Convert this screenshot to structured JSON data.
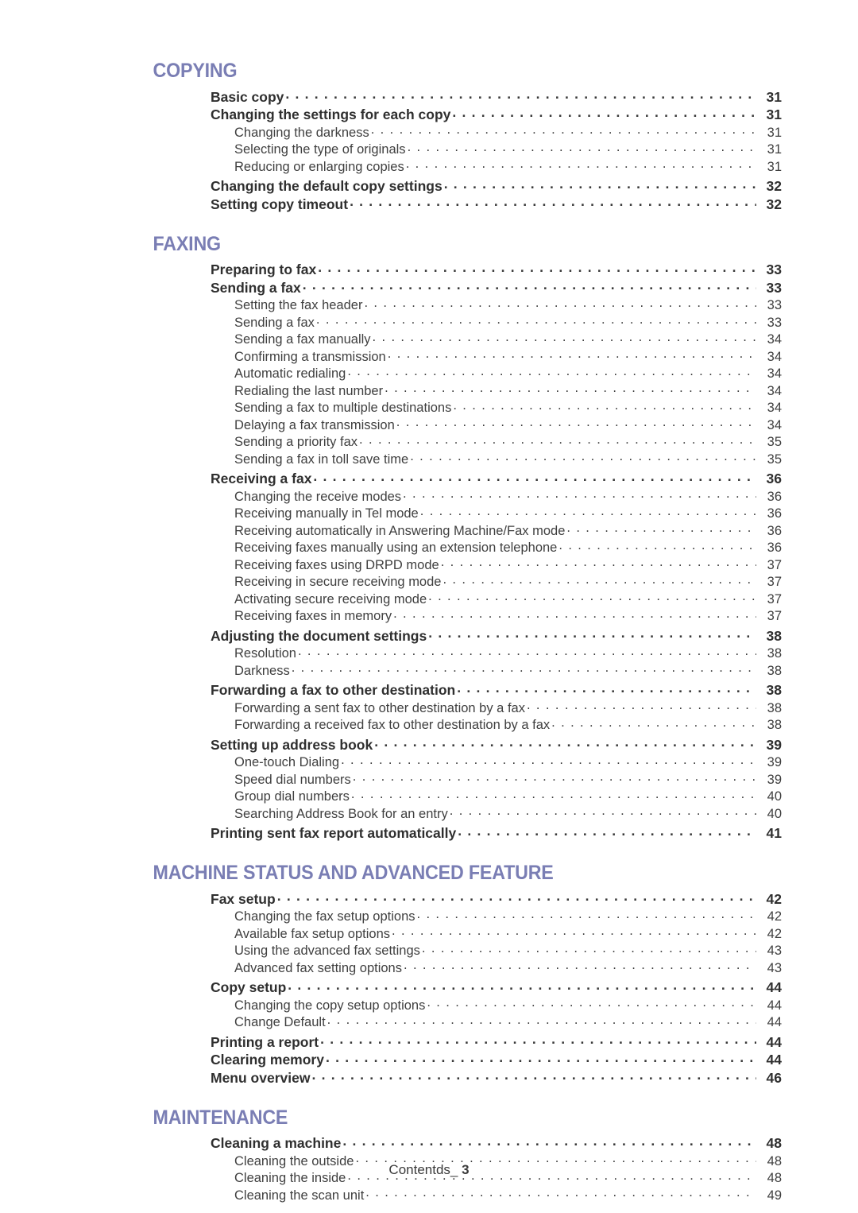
{
  "document": {
    "footer_label": "Contentds_",
    "footer_page_number": "3",
    "heading_color": "#7a7eb4",
    "text_color": "#3a3a3a"
  },
  "sections": [
    {
      "title": "COPYING",
      "entries": [
        {
          "level": 1,
          "label": "Basic copy",
          "page": "31"
        },
        {
          "level": 1,
          "label": "Changing the settings for each copy",
          "page": "31"
        },
        {
          "level": 2,
          "label": "Changing the darkness",
          "page": "31"
        },
        {
          "level": 2,
          "label": "Selecting the type of originals",
          "page": "31"
        },
        {
          "level": 2,
          "label": "Reducing or enlarging copies",
          "page": "31"
        },
        {
          "level": 1,
          "label": "Changing the default copy settings",
          "page": "32"
        },
        {
          "level": 1,
          "label": "Setting copy timeout",
          "page": "32"
        }
      ]
    },
    {
      "title": "FAXING",
      "entries": [
        {
          "level": 1,
          "label": "Preparing to fax",
          "page": "33"
        },
        {
          "level": 1,
          "label": "Sending a fax",
          "page": "33"
        },
        {
          "level": 2,
          "label": "Setting the fax header",
          "page": "33"
        },
        {
          "level": 2,
          "label": "Sending a fax",
          "page": "33"
        },
        {
          "level": 2,
          "label": "Sending a fax manually",
          "page": "34"
        },
        {
          "level": 2,
          "label": "Confirming a transmission",
          "page": "34"
        },
        {
          "level": 2,
          "label": "Automatic redialing",
          "page": "34"
        },
        {
          "level": 2,
          "label": "Redialing the last number",
          "page": "34"
        },
        {
          "level": 2,
          "label": "Sending a fax to multiple destinations",
          "page": "34"
        },
        {
          "level": 2,
          "label": "Delaying a fax transmission",
          "page": "34"
        },
        {
          "level": 2,
          "label": "Sending a priority fax",
          "page": "35"
        },
        {
          "level": 2,
          "label": "Sending a fax in toll save time",
          "page": "35"
        },
        {
          "level": 1,
          "label": "Receiving a fax",
          "page": "36"
        },
        {
          "level": 2,
          "label": "Changing the receive modes",
          "page": "36"
        },
        {
          "level": 2,
          "label": "Receiving manually in Tel mode",
          "page": "36"
        },
        {
          "level": 2,
          "label": "Receiving automatically in Answering Machine/Fax mode",
          "page": "36"
        },
        {
          "level": 2,
          "label": "Receiving faxes manually using an extension telephone",
          "page": "36"
        },
        {
          "level": 2,
          "label": "Receiving faxes using DRPD mode",
          "page": "37"
        },
        {
          "level": 2,
          "label": "Receiving in secure receiving mode",
          "page": "37"
        },
        {
          "level": 2,
          "label": "Activating secure receiving mode",
          "page": "37"
        },
        {
          "level": 2,
          "label": "Receiving faxes in memory",
          "page": "37"
        },
        {
          "level": 1,
          "label": "Adjusting the document settings",
          "page": "38"
        },
        {
          "level": 2,
          "label": "Resolution",
          "page": "38"
        },
        {
          "level": 2,
          "label": "Darkness",
          "page": "38"
        },
        {
          "level": 1,
          "label": "Forwarding a fax to other destination",
          "page": "38"
        },
        {
          "level": 2,
          "label": "Forwarding a sent fax to other destination by a fax",
          "page": "38"
        },
        {
          "level": 2,
          "label": "Forwarding a received fax to other destination by a fax",
          "page": "38"
        },
        {
          "level": 1,
          "label": "Setting up address book",
          "page": "39"
        },
        {
          "level": 2,
          "label": "One-touch Dialing",
          "page": "39"
        },
        {
          "level": 2,
          "label": "Speed dial numbers",
          "page": "39"
        },
        {
          "level": 2,
          "label": "Group dial numbers",
          "page": "40"
        },
        {
          "level": 2,
          "label": "Searching Address Book for an entry",
          "page": "40"
        },
        {
          "level": 1,
          "label": "Printing sent fax report automatically",
          "page": "41"
        }
      ]
    },
    {
      "title": "MACHINE STATUS AND ADVANCED FEATURE",
      "entries": [
        {
          "level": 1,
          "label": "Fax setup",
          "page": "42"
        },
        {
          "level": 2,
          "label": "Changing the fax setup options",
          "page": "42"
        },
        {
          "level": 2,
          "label": "Available fax setup options",
          "page": "42"
        },
        {
          "level": 2,
          "label": "Using the advanced fax settings",
          "page": "43"
        },
        {
          "level": 2,
          "label": "Advanced fax setting options",
          "page": "43"
        },
        {
          "level": 1,
          "label": "Copy setup",
          "page": "44"
        },
        {
          "level": 2,
          "label": "Changing the copy setup options",
          "page": "44"
        },
        {
          "level": 2,
          "label": "Change Default",
          "page": "44"
        },
        {
          "level": 1,
          "label": "Printing a report",
          "page": "44"
        },
        {
          "level": 1,
          "label": "Clearing memory",
          "page": "44"
        },
        {
          "level": 1,
          "label": "Menu overview",
          "page": "46"
        }
      ]
    },
    {
      "title": "MAINTENANCE",
      "entries": [
        {
          "level": 1,
          "label": "Cleaning a machine",
          "page": "48"
        },
        {
          "level": 2,
          "label": "Cleaning the outside",
          "page": "48"
        },
        {
          "level": 2,
          "label": "Cleaning the inside",
          "page": "48"
        },
        {
          "level": 2,
          "label": "Cleaning the scan unit",
          "page": "49"
        }
      ]
    }
  ]
}
